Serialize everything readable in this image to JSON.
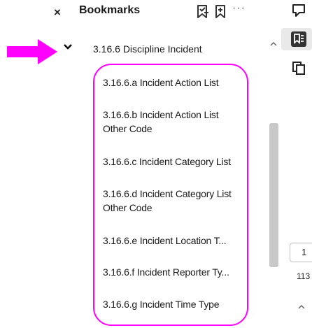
{
  "header": {
    "close_label": "×",
    "title": "Bookmarks",
    "icons": [
      "bookmark-add-icon",
      "bookmark-new-icon",
      "more-options-icon"
    ],
    "more_label": "···"
  },
  "bookmarks": {
    "root": {
      "label": "3.16.6  Discipline Incident",
      "expanded": true
    },
    "children": [
      {
        "label": "3.16.6.a Incident Action List"
      },
      {
        "label": "3.16.6.b Incident Action List Other Code"
      },
      {
        "label": "3.16.6.c Incident Category List"
      },
      {
        "label": "3.16.6.d Incident Category List Other Code"
      },
      {
        "label": "3.16.6.e  Incident Location T..."
      },
      {
        "label": "3.16.6.f Incident Reporter Ty..."
      },
      {
        "label": "3.16.6.g Incident Time Type"
      }
    ]
  },
  "annotation": {
    "arrow_color": "#ff00ff",
    "highlight_color": "#ff00ff"
  },
  "rightbar": {
    "icons": [
      "comment-icon",
      "bookmarks-panel-icon",
      "pages-icon"
    ],
    "current_page": "1",
    "total_pages": "113"
  }
}
